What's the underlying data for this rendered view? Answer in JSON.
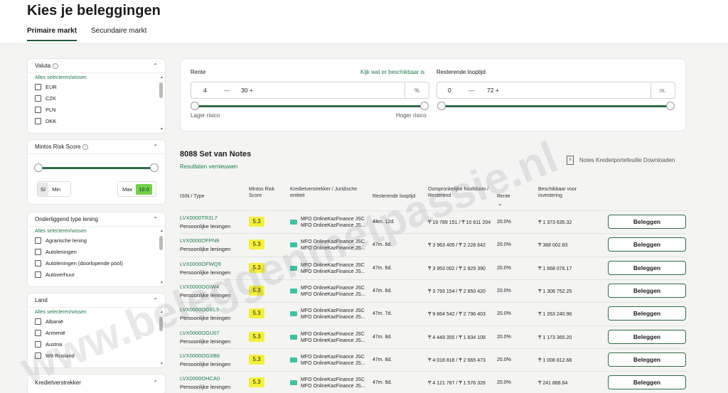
{
  "page": {
    "title": "Kies je beleggingen"
  },
  "tabs": [
    {
      "label": "Primaire markt"
    },
    {
      "label": "Secundaire markt"
    }
  ],
  "filters": {
    "valuta": {
      "title": "Valuta",
      "select_all": "Alles selecteren/wissen",
      "options": [
        "EUR",
        "CZK",
        "PLN",
        "DKK"
      ]
    },
    "risk": {
      "title": "Mintos Risk Score",
      "si_label": "SI",
      "min_label": "Min",
      "max_label": "Max",
      "max_value": "10.0"
    },
    "loan_type": {
      "title": "Onderliggend type lening",
      "select_all": "Alles selecteren/wissen",
      "options": [
        "Agrarische lening",
        "Autoleningen",
        "Autoleningen (doorlopende pool)",
        "Autoverhuur"
      ]
    },
    "land": {
      "title": "Land",
      "select_all": "Alles selecteren/wissen",
      "options": [
        "Albanië",
        "Armenië",
        "Austria",
        "Wit-Rusland"
      ]
    },
    "lender": {
      "title": "Kredietverstrekker"
    }
  },
  "range": {
    "rente_label": "Rente",
    "rente_link": "Kijk wat er beschikbaar is",
    "rente_min": "4",
    "rente_max": "30 +",
    "rente_unit": "%",
    "rente_low": "Lager risico",
    "rente_high": "Hoger risico",
    "loop_label": "Resterende looptijd",
    "loop_min": "0",
    "loop_max": "72 +",
    "loop_unit": "m.",
    "dash": "—"
  },
  "results": {
    "count_title": "8088 Set van Notes",
    "refresh": "Resultaten vernieuwen",
    "download": "Notes Kredietportefeuille Downloaden",
    "headers": {
      "isin": "ISIN / Type",
      "score": "Mintos Risk Score",
      "lender": "Kredietverstrekker / Juridische entiteit",
      "term": "Resterende looptijd",
      "principal": "Oorspronkelijke hoofdsom / Resterend",
      "rate": "Rente",
      "rate_sort": "⌄",
      "available": "Beschikbaar voor investering"
    },
    "rows": [
      {
        "isin": "LVX0000TR2L7",
        "type": "Persoonlijke leningen",
        "score": "5.3",
        "lender1": "MFO OnlineKazFinance JSC",
        "lender2": "MFO OnlineKazFinance JS...",
        "term": "44m. 12d.",
        "principal": "₸ 19 789 151 / ₸ 10 611 204",
        "rate": "20.0%",
        "available": "₸ 1 373 635.32",
        "button": "Beleggen"
      },
      {
        "isin": "LVX0000OFPN9",
        "type": "Persoonlijke leningen",
        "score": "5.3",
        "lender1": "MFO OnlineKazFinance JSC",
        "lender2": "MFO OnlineKazFinance JS...",
        "term": "47m. 6d.",
        "principal": "₸ 3 963 405 / ₸ 2 228 642",
        "rate": "20.0%",
        "available": "₸ 368 002.83",
        "button": "Beleggen"
      },
      {
        "isin": "LVX0000OFWQ9",
        "type": "Persoonlijke leningen",
        "score": "5.3",
        "lender1": "MFO OnlineKazFinance JSC",
        "lender2": "MFO OnlineKazFinance JS...",
        "term": "47m. 6d.",
        "principal": "₸ 3 953 002 / ₸ 2 929 390",
        "rate": "20.0%",
        "available": "₸ 1 668 076.17",
        "button": "Beleggen"
      },
      {
        "isin": "LVX0000OGIW4",
        "type": "Persoonlijke leningen",
        "score": "5.3",
        "lender1": "MFO OnlineKazFinance JSC",
        "lender2": "MFO OnlineKazFinance JS...",
        "term": "47m. 6d.",
        "principal": "₸ 3 793 154 / ₸ 2 850 420",
        "rate": "20.0%",
        "available": "₸ 1 308 752.25",
        "button": "Beleggen"
      },
      {
        "isin": "LVX0000OGEL5",
        "type": "Persoonlijke leningen",
        "score": "5.3",
        "lender1": "MFO OnlineKazFinance JSC",
        "lender2": "MFO OnlineKazFinance JS...",
        "term": "47m. 7d.",
        "principal": "₸ 9 864 542 / ₸ 2 796 403",
        "rate": "20.0%",
        "available": "₸ 1 263 240.96",
        "button": "Beleggen"
      },
      {
        "isin": "LVX0000OGU07",
        "type": "Persoonlijke leningen",
        "score": "5.3",
        "lender1": "MFO OnlineKazFinance JSC",
        "lender2": "MFO OnlineKazFinance JS...",
        "term": "47m. 8d.",
        "principal": "₸ 4 449 355 / ₸ 1 834 108",
        "rate": "20.0%",
        "available": "₸ 1 173 365.20",
        "button": "Beleggen"
      },
      {
        "isin": "LVX0000OGXB6",
        "type": "Persoonlijke leningen",
        "score": "5.3",
        "lender1": "MFO OnlineKazFinance JSC",
        "lender2": "MFO OnlineKazFinance JS...",
        "term": "47m. 8d.",
        "principal": "₸ 4 018 818 / ₸ 2 665 473",
        "rate": "20.0%",
        "available": "₸ 1 008 812.68",
        "button": "Beleggen"
      },
      {
        "isin": "LVX0000OHCA0",
        "type": "Persoonlijke leningen",
        "score": "5.3",
        "lender1": "MFO OnlineKazFinance JSC",
        "lender2": "MFO OnlineKazFinance JS...",
        "term": "47m. 9d.",
        "principal": "₸ 4 121 787 / ₸ 1 576 326",
        "rate": "20.0%",
        "available": "₸ 241 888.64",
        "button": "Beleggen"
      }
    ]
  },
  "watermark": "www.beleggenmetpassie.nl"
}
